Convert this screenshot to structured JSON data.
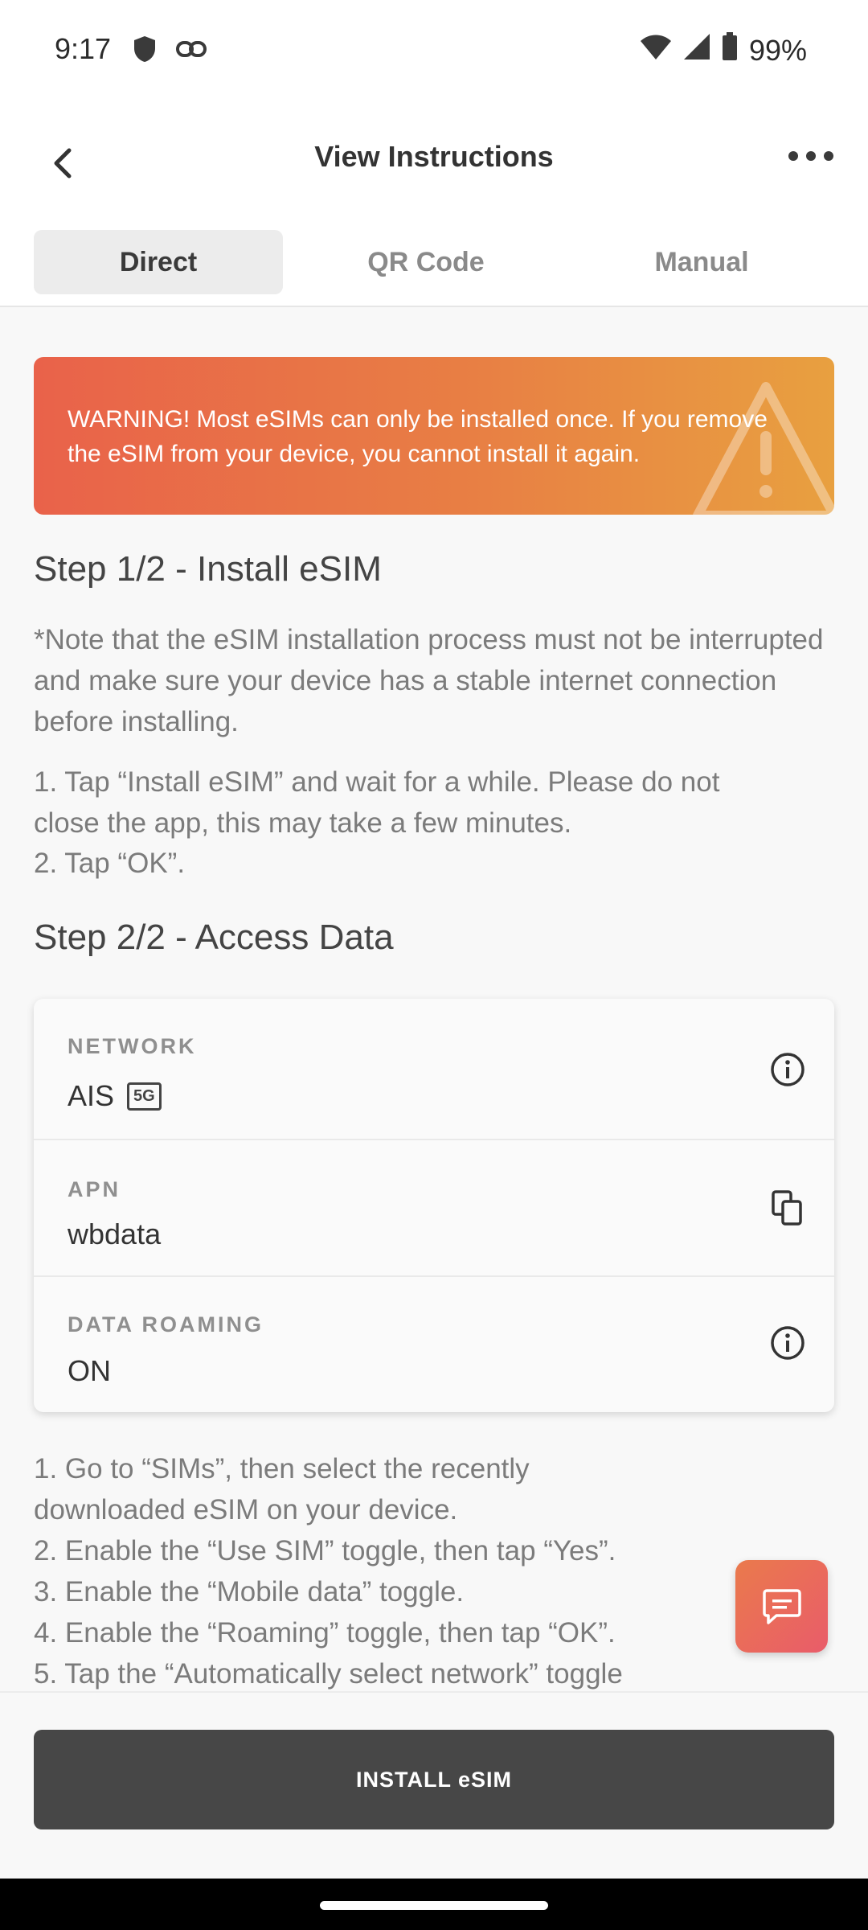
{
  "status_bar": {
    "time": "9:17",
    "battery": "99%",
    "left_icons": [
      "shield-icon",
      "link-icon"
    ],
    "right_icons": [
      "wifi-icon",
      "cellular-signal-icon",
      "battery-icon"
    ]
  },
  "header": {
    "title": "View Instructions"
  },
  "tabs": [
    {
      "label": "Direct",
      "active": true
    },
    {
      "label": "QR Code",
      "active": false
    },
    {
      "label": "Manual",
      "active": false
    }
  ],
  "warning": {
    "text": "WARNING! Most eSIMs can only be installed once. If you remove the eSIM from your device, you cannot install it again.",
    "icon": "warning-triangle-icon"
  },
  "step1": {
    "title": "Step 1/2 - Install eSIM",
    "note": "*Note that the eSIM installation process must not be interrupted and make sure your device has a stable internet connection before installing.",
    "instructions": [
      "1. Tap “Install eSIM” and wait for a while. Please do not close the app, this may take a few minutes.",
      "2. Tap “OK”."
    ]
  },
  "step2": {
    "title": "Step 2/2 - Access Data",
    "card": {
      "network_label": "NETWORK",
      "network_value": "AIS",
      "network_badge": "5G",
      "apn_label": "APN",
      "apn_value": "wbdata",
      "roaming_label": "DATA ROAMING",
      "roaming_value": "ON"
    },
    "instructions": [
      "1. Go to “SIMs”, then select the recently downloaded eSIM on your device.",
      "2. Enable the “Use SIM” toggle, then tap “Yes”.",
      "3. Enable the “Mobile data” toggle.",
      "4. Enable the “Roaming” toggle, then tap “OK”.",
      "5. Tap the “Automatically select network” toggle"
    ]
  },
  "install_button": {
    "label": "INSTALL eSIM"
  },
  "colors": {
    "warning_gradient_start": "#e9624a",
    "warning_gradient_end": "#e8a040",
    "install_button_bg": "#474747",
    "chat_fab": "#e95c6a"
  }
}
